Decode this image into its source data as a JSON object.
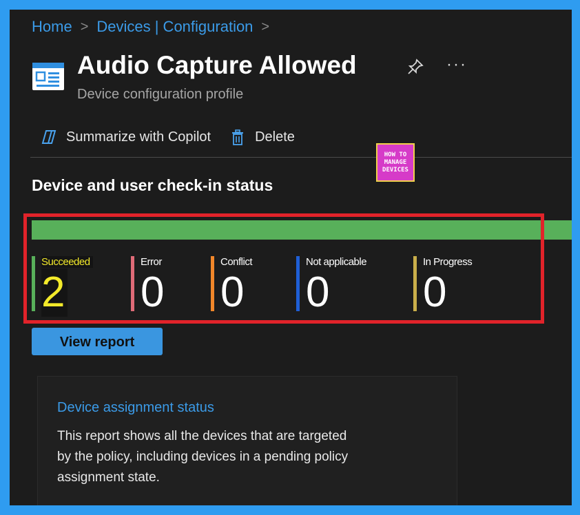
{
  "breadcrumb": {
    "items": [
      "Home",
      "Devices | Configuration"
    ]
  },
  "header": {
    "title": "Audio Capture Allowed",
    "subtitle": "Device configuration profile",
    "more": "···"
  },
  "toolbar": {
    "copilot_label": "Summarize with Copilot",
    "delete_label": "Delete"
  },
  "logo": {
    "line1": "HOW TO",
    "line2": "MANAGE",
    "line3": "DEVICES"
  },
  "checkin": {
    "title": "Device and user check-in status",
    "stats": [
      {
        "label": "Succeeded",
        "value": "2",
        "color": "#58b05a"
      },
      {
        "label": "Error",
        "value": "0",
        "color": "#e06b78"
      },
      {
        "label": "Conflict",
        "value": "0",
        "color": "#f2872a"
      },
      {
        "label": "Not applicable",
        "value": "0",
        "color": "#1f5fd6"
      },
      {
        "label": "In Progress",
        "value": "0",
        "color": "#c9ae4a"
      }
    ],
    "view_report_label": "View report"
  },
  "assignment_card": {
    "title": "Device assignment status",
    "description": "This report shows all the devices that are targeted by the policy, including devices in a pending policy assignment state."
  }
}
